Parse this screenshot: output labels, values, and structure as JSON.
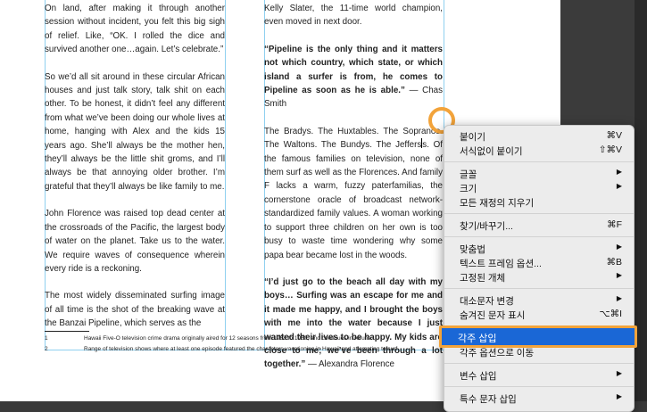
{
  "document": {
    "left_column": [
      "On land, after making it through another session without incident, you felt this big sigh of relief. Like, “OK. I rolled the dice and survived another one…again. Let’s celebrate.”",
      "So we’d all sit around in these circular African houses and just talk story, talk shit on each other. To be honest, it didn’t feel any different from what we’ve been doing our whole lives at home, hanging with Alex and the kids 15 years ago. She’ll always be the mother hen, they’ll always be the little shit groms, and I’ll always be that annoying older brother. I’m grateful that they’ll always be like family to me.",
      "John Florence was raised top dead center at the crossroads of the Pacific, the largest body of water on the planet. Take us to the water. We require waves of consequence wherein every ride is a reckoning.",
      "The most widely disseminated surfing image of all time is the shot of the breaking wave at the Banzai Pipeline, which serves as the"
    ],
    "right_column": {
      "p1": "Kelly Slater, the 11-time world champion, even moved in next door.",
      "quote1": "“Pipeline is the only thing and it matters not which country, which state, or which island a surfer is from, he comes to Pipeline as soon as he is able.”",
      "quote1_attr": " — Chas Smith",
      "p2_before_cursor": "The Bradys. The Huxtables. The Sopranos. The Waltons. The Bundys. The Jeffers",
      "p2_after_cursor": "s. Of the famous families on television, none of them surf as well as the Florences. And family F lacks a warm, fuzzy paterfamilias, the cornerstone oracle of broadcast network-standardized family values. A woman working to support three children on her own is too busy to waste time wondering why some papa bear became lost in the woods.",
      "quote2": "“I’d just go to the beach all day with my boys… Surfing was an escape for me and it made me happy, and I brought the boys with me into the water because I just wanted their lives to be happy. My kids are close to me; we’ve been through a lot together.”",
      "quote2_attr": " — Alexandra Florence"
    },
    "footnotes": [
      {
        "num": "1",
        "text": "Hawaii Five-O television crime drama originally aired for 12 seasons from 1968 to 1980, and continues in reruns."
      },
      {
        "num": "2",
        "text": "Range of television shows where at least one episode featured the characters vacationing in Hawaii and attempting to surf."
      }
    ]
  },
  "context_menu": {
    "items": [
      {
        "label": "붙이기",
        "shortcut": "⌘V"
      },
      {
        "label": "서식없이 붙이기",
        "shortcut": "⇧⌘V"
      },
      {
        "label": "글꼴",
        "submenu": true
      },
      {
        "label": "크기",
        "submenu": true
      },
      {
        "label": "모든 재정의 지우기"
      },
      {
        "label": "찾기/바꾸기...",
        "shortcut": "⌘F"
      },
      {
        "label": "맞춤법",
        "submenu": true
      },
      {
        "label": "텍스트 프레임 옵션...",
        "shortcut": "⌘B"
      },
      {
        "label": "고정된 개체",
        "submenu": true
      },
      {
        "label": "대소문자 변경",
        "submenu": true
      },
      {
        "label": "숨겨진 문자 표시",
        "shortcut": "⌥⌘I"
      },
      {
        "label": "각주 삽입",
        "highlighted": true
      },
      {
        "label": "각주 옵션으로 이동"
      },
      {
        "label": "변수 삽입",
        "submenu": true
      },
      {
        "label": "특수 문자 삽입",
        "submenu": true
      }
    ],
    "submenu_arrow": "▶"
  },
  "colors": {
    "highlight": "#1a67d6",
    "callout": "#f2a33a",
    "guide": "#8fd0f0"
  }
}
